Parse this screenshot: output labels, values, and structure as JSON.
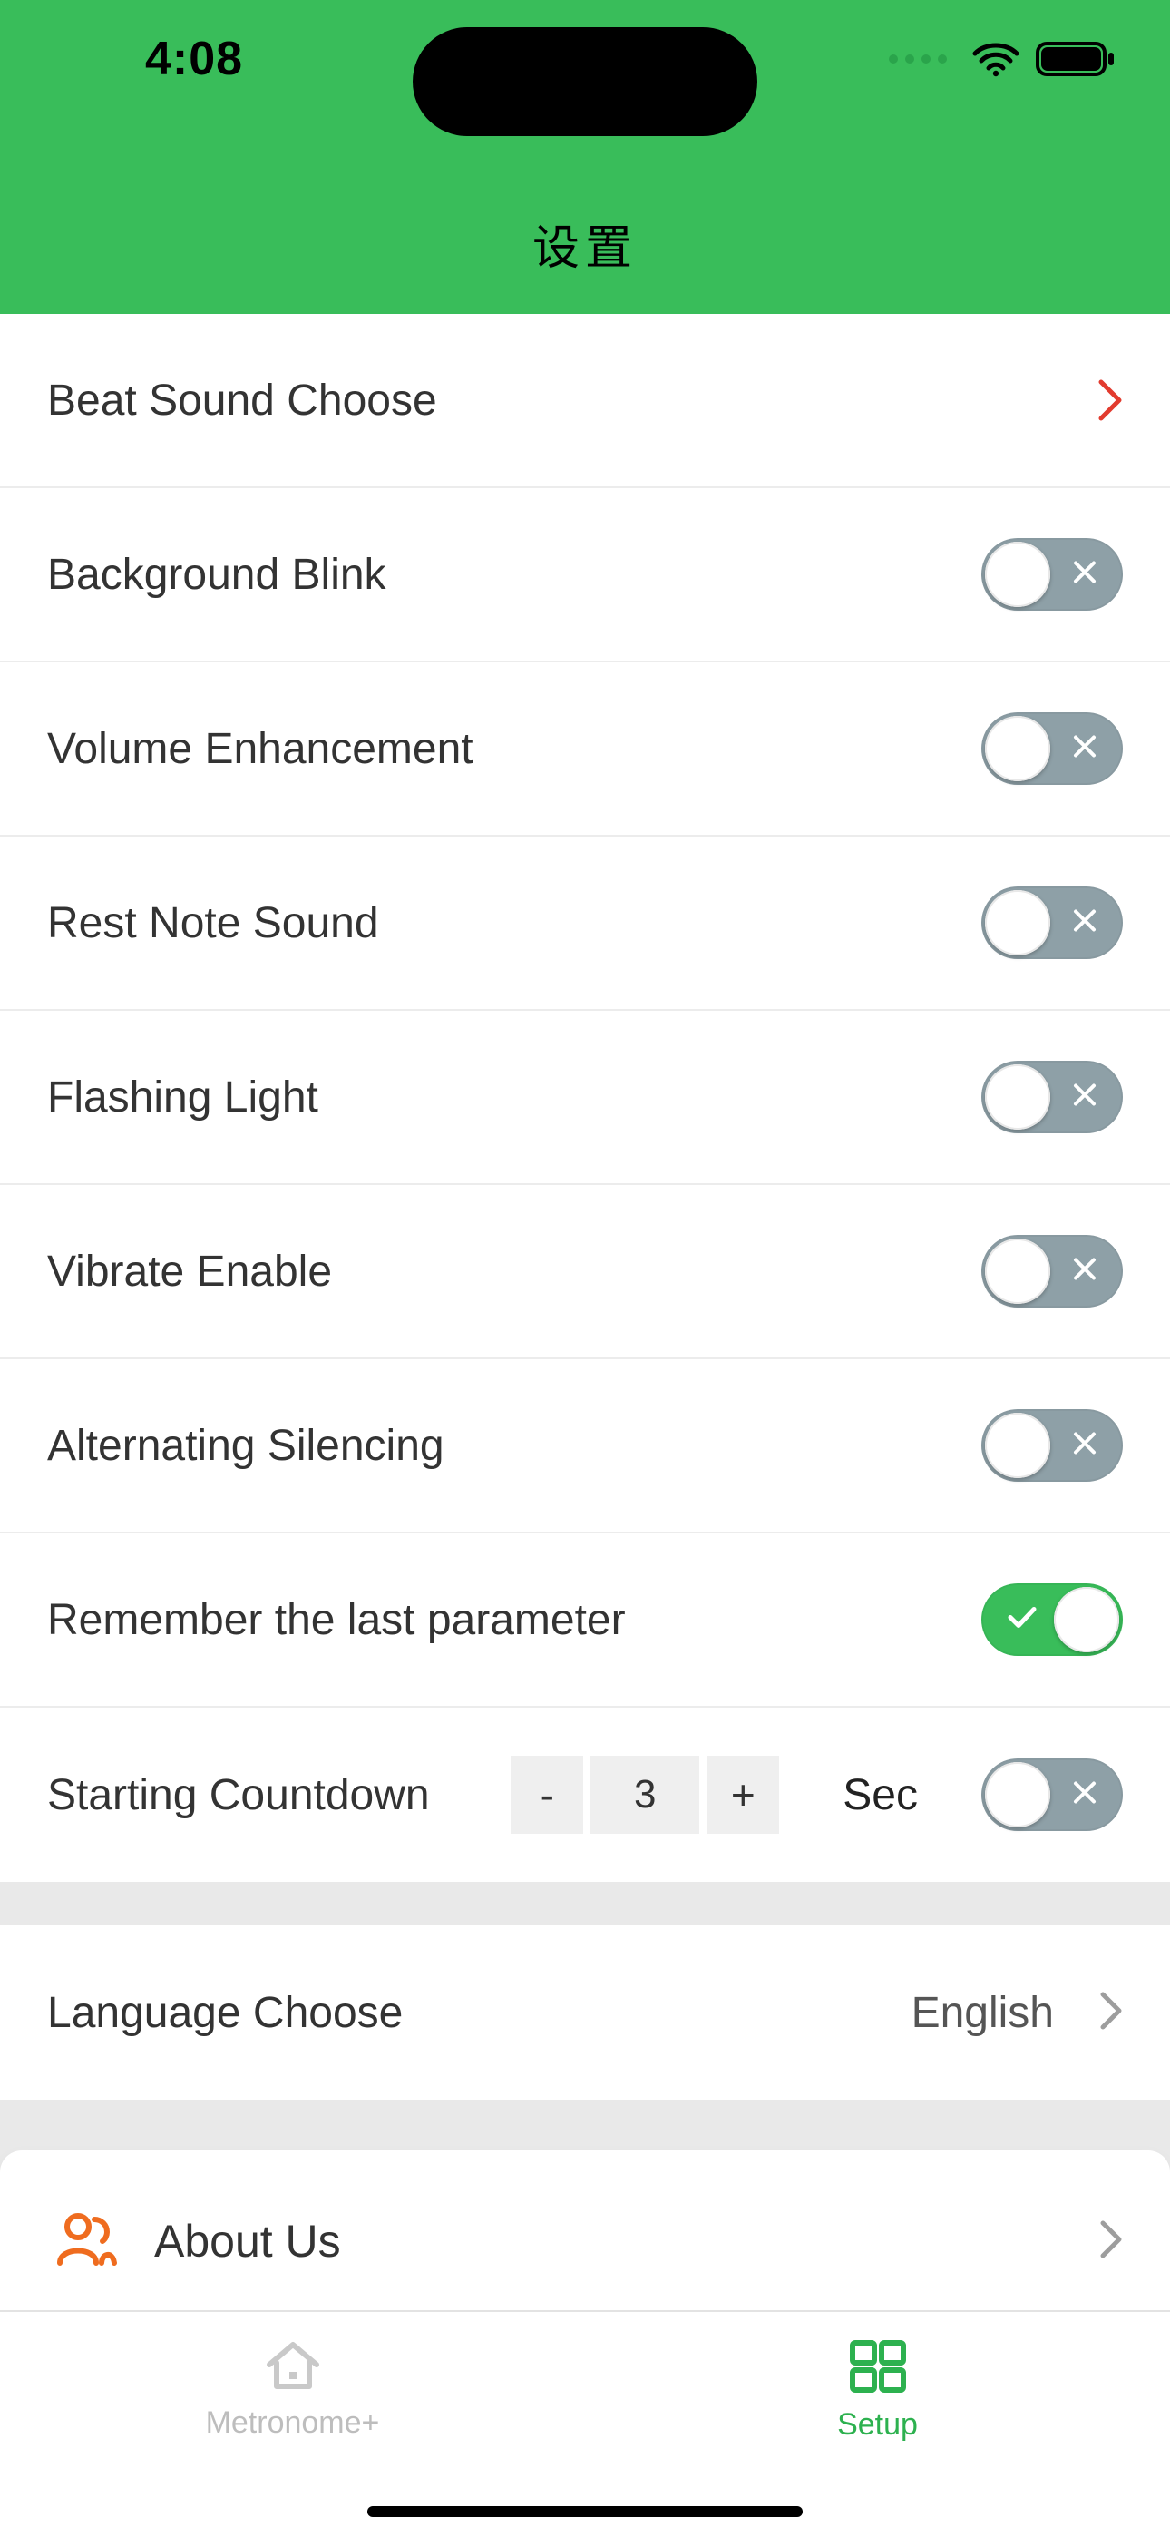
{
  "status": {
    "time": "4:08"
  },
  "header": {
    "title": "设置"
  },
  "settings": {
    "beat_sound_choose": "Beat Sound Choose",
    "background_blink": "Background Blink",
    "volume_enhancement": "Volume Enhancement",
    "rest_note_sound": "Rest Note Sound",
    "flashing_light": "Flashing Light",
    "vibrate_enable": "Vibrate Enable",
    "alternating_silencing": "Alternating Silencing",
    "remember_last": "Remember the last parameter",
    "starting_countdown": "Starting Countdown",
    "countdown_value": "3",
    "countdown_unit": "Sec",
    "minus": "-",
    "plus": "+",
    "toggles": {
      "background_blink": false,
      "volume_enhancement": false,
      "rest_note_sound": false,
      "flashing_light": false,
      "vibrate_enable": false,
      "alternating_silencing": false,
      "remember_last": true,
      "starting_countdown": false
    }
  },
  "language": {
    "label": "Language Choose",
    "value": "English"
  },
  "about": {
    "label": "About Us"
  },
  "tabs": {
    "metronome": "Metronome+",
    "setup": "Setup"
  },
  "colors": {
    "accent_green": "#39bd5a",
    "accent_orange": "#ef6c1f",
    "chevron_red": "#e23b2e"
  }
}
